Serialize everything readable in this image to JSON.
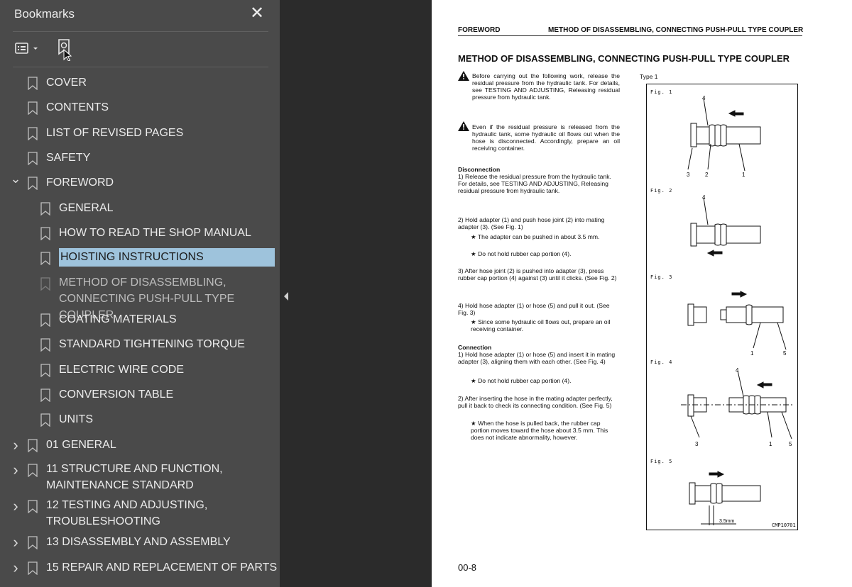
{
  "sidebar": {
    "title": "Bookmarks",
    "close_icon": "close-icon",
    "options_icon": "bookmark-options-icon",
    "find_icon": "find-current-bookmark-icon",
    "items": [
      {
        "label": "COVER",
        "level": 0,
        "expand": "none"
      },
      {
        "label": "CONTENTS",
        "level": 0,
        "expand": "none"
      },
      {
        "label": "LIST OF REVISED PAGES",
        "level": 0,
        "expand": "none"
      },
      {
        "label": "SAFETY",
        "level": 0,
        "expand": "none"
      },
      {
        "label": "FOREWORD",
        "level": 0,
        "expand": "expanded"
      },
      {
        "label": "GENERAL",
        "level": 1,
        "expand": "none"
      },
      {
        "label": "HOW TO READ THE SHOP MANUAL",
        "level": 1,
        "expand": "none"
      },
      {
        "label": "HOISTING INSTRUCTIONS",
        "level": 1,
        "expand": "none",
        "selected": true
      },
      {
        "label": "METHOD OF DISASSEMBLING, CONNECTING PUSH-PULL TYPE COUPLER",
        "level": 1,
        "expand": "none",
        "dim": true
      },
      {
        "label": "COATING MATERIALS",
        "level": 1,
        "expand": "none"
      },
      {
        "label": "STANDARD TIGHTENING TORQUE",
        "level": 1,
        "expand": "none"
      },
      {
        "label": "ELECTRIC WIRE CODE",
        "level": 1,
        "expand": "none"
      },
      {
        "label": "CONVERSION TABLE",
        "level": 1,
        "expand": "none"
      },
      {
        "label": "UNITS",
        "level": 1,
        "expand": "none"
      },
      {
        "label": "01 GENERAL",
        "level": 0,
        "expand": "collapsed"
      },
      {
        "label": "11 STRUCTURE AND FUNCTION, MAINTENANCE STANDARD",
        "level": 0,
        "expand": "collapsed"
      },
      {
        "label": "12 TESTING AND ADJUSTING, TROUBLESHOOTING",
        "level": 0,
        "expand": "collapsed"
      },
      {
        "label": "13 DISASSEMBLY AND ASSEMBLY",
        "level": 0,
        "expand": "collapsed"
      },
      {
        "label": "15 REPAIR AND REPLACEMENT OF PARTS",
        "level": 0,
        "expand": "collapsed"
      }
    ]
  },
  "page": {
    "header_left": "FOREWORD",
    "header_right": "METHOD OF DISASSEMBLING, CONNECTING PUSH-PULL TYPE COUPLER",
    "title": "METHOD OF DISASSEMBLING, CONNECTING PUSH-PULL TYPE COUPLER",
    "warnings": [
      "Before carrying out the following work, release the residual pressure from the hydraulic tank. For details, see TESTING AND ADJUSTING, Releasing residual pressure from hydraulic tank.",
      "Even if the residual pressure is released from the hydraulic tank, some hydraulic oil flows out when the hose is disconnected. Accordingly, prepare an oil receiving container."
    ],
    "disconnection_heading": "Disconnection",
    "disconnection_steps": [
      "1) Release the residual pressure from the hydraulic tank. For details, see TESTING AND ADJUSTING, Releasing residual pressure from hydraulic tank.",
      "2) Hold adapter (1) and push hose joint (2) into mating adapter (3). (See Fig. 1)",
      "★ The adapter can be pushed in about 3.5 mm.",
      "★ Do not hold rubber cap portion (4).",
      "3) After hose joint (2) is pushed into adapter (3), press rubber cap portion (4) against (3) until it clicks. (See Fig. 2)",
      "4) Hold hose adapter (1) or hose (5) and pull it out. (See Fig. 3)",
      "★ Since some hydraulic oil flows out, prepare an oil receiving container."
    ],
    "connection_heading": "Connection",
    "connection_steps": [
      "1) Hold hose adapter (1) or hose (5) and insert it in mating adapter (3), aligning them with each other. (See Fig. 4)",
      "★ Do not hold rubber cap portion (4).",
      "2) After inserting the hose in the mating adapter perfectly, pull it back to check its connecting condition. (See Fig. 5)",
      "★ When the hose is pulled back, the rubber cap portion moves toward the hose about 3.5 mm. This does not indicate abnormality, however."
    ],
    "type_label": "Type 1",
    "figures": [
      "Fig. 1",
      "Fig. 2",
      "Fig. 3",
      "Fig. 4",
      "Fig. 5"
    ],
    "fig_code": "CMP10701",
    "fig_dim": "3.5mm",
    "callouts": {
      "f1": [
        "4",
        "3",
        "2",
        "1"
      ],
      "f2": [
        "4"
      ],
      "f3": [
        "1",
        "5"
      ],
      "f4": [
        "4",
        "3",
        "1",
        "5"
      ]
    },
    "page_number": "00-8"
  }
}
